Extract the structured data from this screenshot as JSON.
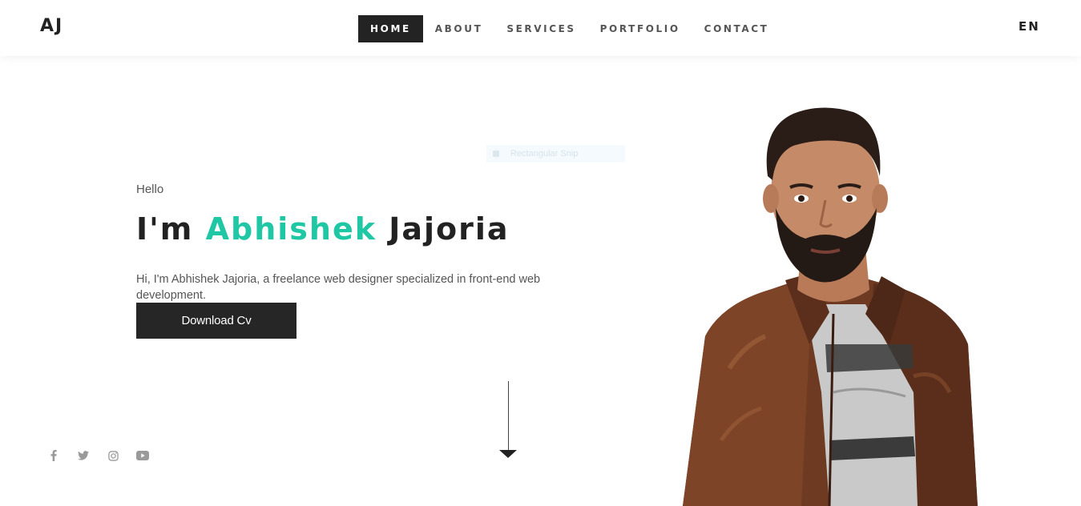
{
  "header": {
    "logo": "AJ",
    "nav": [
      {
        "label": "HOME",
        "active": true
      },
      {
        "label": "ABOUT",
        "active": false
      },
      {
        "label": "SERVICES",
        "active": false
      },
      {
        "label": "PORTFOLIO",
        "active": false
      },
      {
        "label": "CONTACT",
        "active": false
      }
    ],
    "language": "EN"
  },
  "snip_overlay": {
    "label": "Rectangular Snip"
  },
  "hero": {
    "greeting": "Hello",
    "headline_prefix": "I'm ",
    "headline_accent": "Abhishek",
    "headline_suffix": " Jajoria",
    "description": "Hi, I'm Abhishek Jajoria, a freelance web designer specialized in front-end web development.",
    "cta_label": "Download Cv"
  },
  "social": [
    "facebook-icon",
    "twitter-icon",
    "instagram-icon",
    "youtube-icon"
  ],
  "colors": {
    "accent": "#1fc7a5",
    "dark": "#232323",
    "text": "#555555"
  }
}
